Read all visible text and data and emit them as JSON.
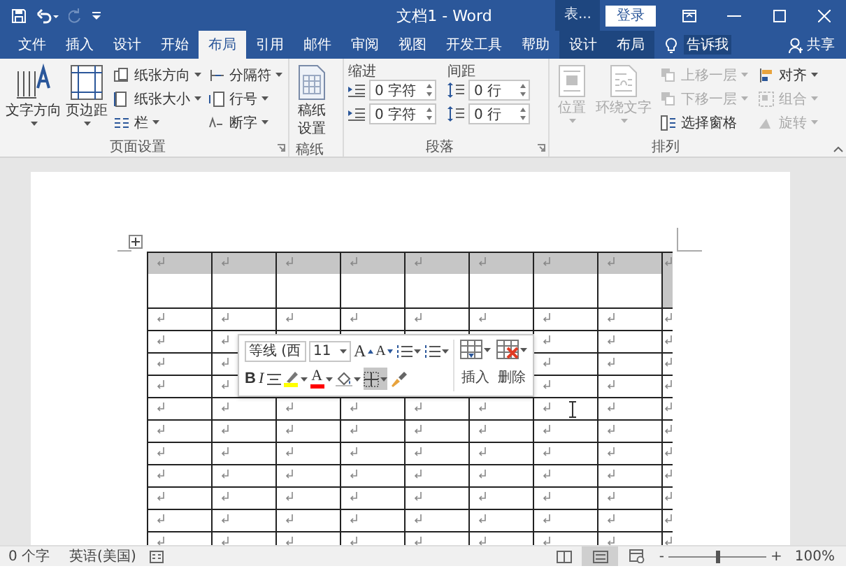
{
  "title_bar": {
    "quick_access": [
      {
        "kind": "save",
        "disabled": false
      },
      {
        "kind": "undo",
        "disabled": false
      },
      {
        "kind": "redo",
        "disabled": true
      },
      {
        "kind": "customize",
        "disabled": false
      }
    ],
    "title": "文档1 - Word",
    "context_label": "表...",
    "sign_in": "登录"
  },
  "tabs": [
    {
      "label": "文件",
      "selected": false,
      "contextual": false
    },
    {
      "label": "插入",
      "selected": false,
      "contextual": false
    },
    {
      "label": "设计",
      "selected": false,
      "contextual": false
    },
    {
      "label": "开始",
      "selected": false,
      "contextual": false
    },
    {
      "label": "布局",
      "selected": true,
      "contextual": false
    },
    {
      "label": "引用",
      "selected": false,
      "contextual": false
    },
    {
      "label": "邮件",
      "selected": false,
      "contextual": false
    },
    {
      "label": "审阅",
      "selected": false,
      "contextual": false
    },
    {
      "label": "视图",
      "selected": false,
      "contextual": false
    },
    {
      "label": "开发工具",
      "selected": false,
      "contextual": false
    },
    {
      "label": "帮助",
      "selected": false,
      "contextual": false
    },
    {
      "label": "设计",
      "selected": false,
      "contextual": true
    },
    {
      "label": "布局",
      "selected": false,
      "contextual": true
    }
  ],
  "tell_me": "告诉我",
  "share": "共享",
  "ribbon": {
    "page_setup": {
      "label": "页面设置",
      "large": [
        {
          "label": "文字方向"
        },
        {
          "label": "页边距"
        }
      ],
      "small": [
        {
          "label": "纸张方向"
        },
        {
          "label": "纸张大小"
        },
        {
          "label": "栏"
        },
        {
          "label": "分隔符"
        },
        {
          "label": "行号"
        },
        {
          "label": "断字"
        }
      ]
    },
    "draft": {
      "label": "稿纸",
      "button": [
        "稿纸",
        "设置"
      ]
    },
    "paragraph": {
      "label": "段落",
      "indent": {
        "title": "缩进",
        "fields": [
          "0 字符",
          "0 字符"
        ]
      },
      "spacing": {
        "title": "间距",
        "fields": [
          "0 行",
          "0 行"
        ]
      }
    },
    "arrange": {
      "label": "排列",
      "large": [
        {
          "label": "位置",
          "disabled": true
        },
        {
          "label": "环绕文字",
          "disabled": true
        }
      ],
      "small": [
        {
          "label": "上移一层",
          "disabled": true,
          "caret": true
        },
        {
          "label": "下移一层",
          "disabled": true,
          "caret": true
        },
        {
          "label": "选择窗格",
          "disabled": false,
          "caret": false
        },
        {
          "label": "对齐",
          "disabled": false,
          "caret": true
        },
        {
          "label": "组合",
          "disabled": true,
          "caret": true
        },
        {
          "label": "旋转",
          "disabled": true,
          "caret": true
        }
      ]
    }
  },
  "table": {
    "rows": [
      {
        "kind": "tall",
        "selected": true
      },
      {
        "kind": "normal",
        "selected": false
      },
      {
        "kind": "normal",
        "selected": false
      },
      {
        "kind": "normal",
        "selected": false
      },
      {
        "kind": "normal",
        "selected": false
      },
      {
        "kind": "normal",
        "selected": false
      },
      {
        "kind": "normal",
        "selected": false
      },
      {
        "kind": "normal",
        "selected": false
      },
      {
        "kind": "normal",
        "selected": false
      },
      {
        "kind": "normal",
        "selected": false
      },
      {
        "kind": "normal",
        "selected": false
      },
      {
        "kind": "normal",
        "selected": false
      }
    ]
  },
  "mini_toolbar": {
    "font": "等线 (西",
    "size": "11",
    "row1": [
      {
        "kind": "grow_font",
        "label": "A"
      },
      {
        "kind": "shrink_font",
        "label": "A"
      },
      {
        "kind": "bullets"
      },
      {
        "kind": "numbering"
      }
    ],
    "row2": [
      {
        "kind": "bold",
        "label": "B",
        "selected": false
      },
      {
        "kind": "italic",
        "label": "I",
        "selected": false
      },
      {
        "kind": "center",
        "selected": false
      },
      {
        "kind": "highlight",
        "color": "#ffff00",
        "selected": false
      },
      {
        "kind": "font_color",
        "label": "A",
        "color": "#ff0000",
        "selected": false
      },
      {
        "kind": "shading",
        "selected": false
      },
      {
        "kind": "borders",
        "selected": true
      },
      {
        "kind": "format_painter",
        "selected": false
      }
    ],
    "big": [
      {
        "kind": "insert",
        "label": "插入"
      },
      {
        "kind": "delete",
        "label": "删除"
      }
    ]
  },
  "status_bar": {
    "word_count": "0 个字",
    "language": "英语(美国)",
    "views": [
      {
        "kind": "read",
        "selected": false
      },
      {
        "kind": "print",
        "selected": true
      },
      {
        "kind": "web",
        "selected": false
      }
    ],
    "zoom_out": "-",
    "zoom_in": "+",
    "zoom": {
      "level": 0.5
    },
    "zoom_text": "100%"
  }
}
